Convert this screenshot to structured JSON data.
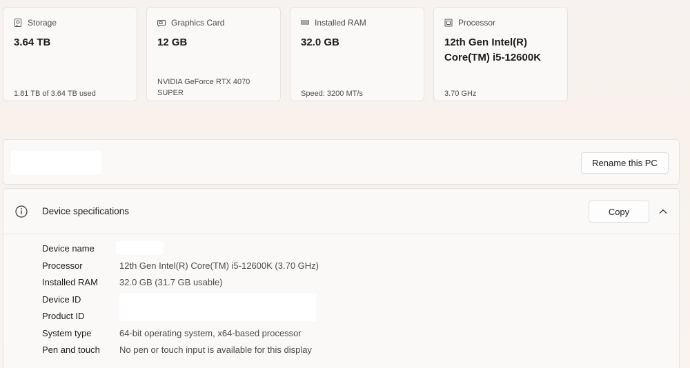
{
  "cards": [
    {
      "icon": "storage-icon",
      "label": "Storage",
      "value": "3.64 TB",
      "sub": "1.81 TB of 3.64 TB used"
    },
    {
      "icon": "graphics-card-icon",
      "label": "Graphics Card",
      "value": "12 GB",
      "sub": "NVIDIA GeForce RTX 4070 SUPER"
    },
    {
      "icon": "ram-icon",
      "label": "Installed RAM",
      "value": "32.0 GB",
      "sub": "Speed: 3200 MT/s"
    },
    {
      "icon": "processor-icon",
      "label": "Processor",
      "value": "12th Gen Intel(R) Core(TM) i5-12600K",
      "sub": "3.70 GHz"
    }
  ],
  "rename": {
    "button_label": "Rename this PC"
  },
  "specs": {
    "title": "Device specifications",
    "copy_label": "Copy",
    "rows": [
      {
        "key": "Device name",
        "value": ""
      },
      {
        "key": "Processor",
        "value": "12th Gen Intel(R) Core(TM) i5-12600K (3.70 GHz)"
      },
      {
        "key": "Installed RAM",
        "value": "32.0 GB (31.7 GB usable)"
      },
      {
        "key": "Device ID",
        "value": ""
      },
      {
        "key": "Product ID",
        "value": ""
      },
      {
        "key": "System type",
        "value": "64-bit operating system, x64-based processor"
      },
      {
        "key": "Pen and touch",
        "value": "No pen or touch input is available for this display"
      }
    ]
  }
}
